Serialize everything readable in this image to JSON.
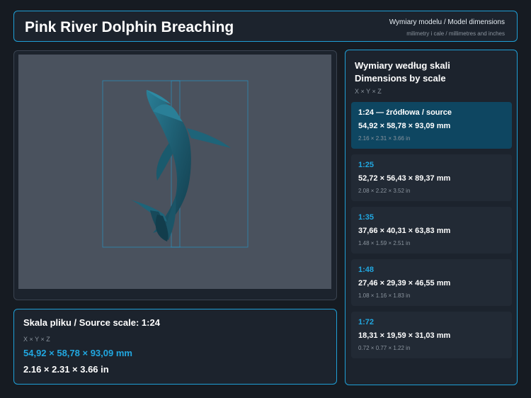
{
  "header": {
    "title": "Pink River Dolphin Breaching",
    "subtitle": "Wymiary modelu / Model dimensions",
    "units_note": "milimetry i cale / millimetres and inches"
  },
  "source_scale": {
    "title": "Skala pliku / Source scale: 1:24",
    "axes": "X × Y × Z",
    "mm": "54,92 × 58,78 × 93,09 mm",
    "inches": "2.16 × 2.31 × 3.66 in"
  },
  "dims": {
    "title_line1": "Wymiary według skali",
    "title_line2": "Dimensions by scale",
    "axes": "X × Y × Z",
    "cards": [
      {
        "scale": "1:24  —  źródłowa / source",
        "mm": "54,92 × 58,78 × 93,09 mm",
        "inches": "2.16 × 2.31 × 3.66 in",
        "active": true
      },
      {
        "scale": "1:25",
        "mm": "52,72 × 56,43 × 89,37 mm",
        "inches": "2.08 × 2.22 × 3.52 in",
        "active": false
      },
      {
        "scale": "1:35",
        "mm": "37,66 × 40,31 × 63,83 mm",
        "inches": "1.48 × 1.59 × 2.51 in",
        "active": false
      },
      {
        "scale": "1:48",
        "mm": "27,46 × 29,39 × 46,55 mm",
        "inches": "1.08 × 1.16 × 1.83 in",
        "active": false
      },
      {
        "scale": "1:72",
        "mm": "18,31 × 19,59 × 31,03 mm",
        "inches": "0.72 × 0.77 × 1.22 in",
        "active": false
      }
    ]
  },
  "colors": {
    "accent": "#21a7e0",
    "active_card": "#0e4661",
    "model": "#1f5f73"
  }
}
